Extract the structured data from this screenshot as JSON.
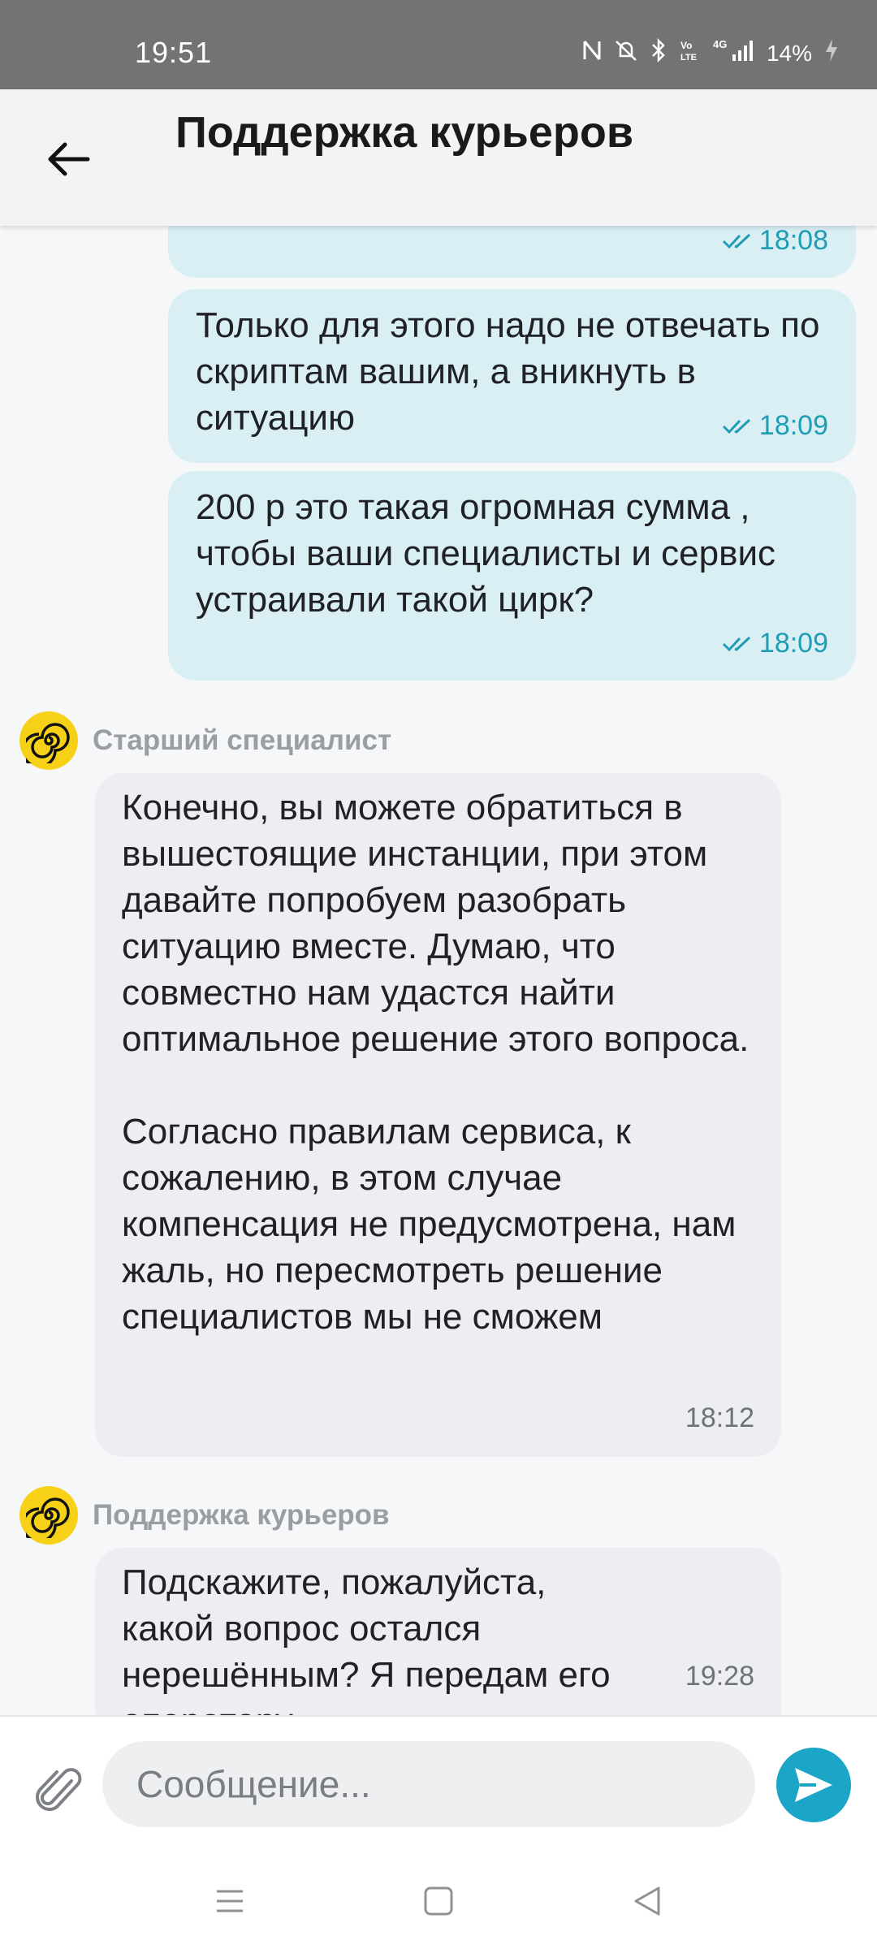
{
  "status_bar": {
    "time": "19:51",
    "battery": "14%",
    "icons": [
      "nfc-icon",
      "mute-icon",
      "bluetooth-icon",
      "volte-icon",
      "signal-icon",
      "battery-icon"
    ],
    "network": "4G"
  },
  "header": {
    "title": "Поддержка курьеров"
  },
  "messages_out": [
    {
      "text": "",
      "time": "18:08"
    },
    {
      "text": "Только для этого надо не отвечать по скриптам вашим, а вникнуть в ситуацию",
      "time": "18:09"
    },
    {
      "text": "200 р это такая огромная сумма , чтобы ваши специалисты и сервис устраивали такой цирк?",
      "time": "18:09"
    }
  ],
  "messages_in": [
    {
      "sender": "Старший специалист",
      "text": "Конечно, вы можете обратиться в вышестоящие инстанции, при этом давайте попробуем разобрать ситуацию вместе. Думаю, что совместно нам удастся найти оптимальное решение этого вопроса.\n\nСогласно правилам сервиса, к сожалению, в этом случае компенсация не предусмотрена, нам жаль, но пересмотреть решение специалистов мы не сможем",
      "time": "18:12"
    },
    {
      "sender": "Поддержка курьеров",
      "text": "Подскажите, пожалуйста, какой вопрос остался нерешённым? Я передам его оператору",
      "time": "19:28"
    }
  ],
  "input": {
    "placeholder": "Сообщение..."
  },
  "colors": {
    "outgoing_bubble": "#d9eff4",
    "incoming_bubble": "#eceef1",
    "accent": "#1ba6c8",
    "avatar": "#f7d117"
  }
}
